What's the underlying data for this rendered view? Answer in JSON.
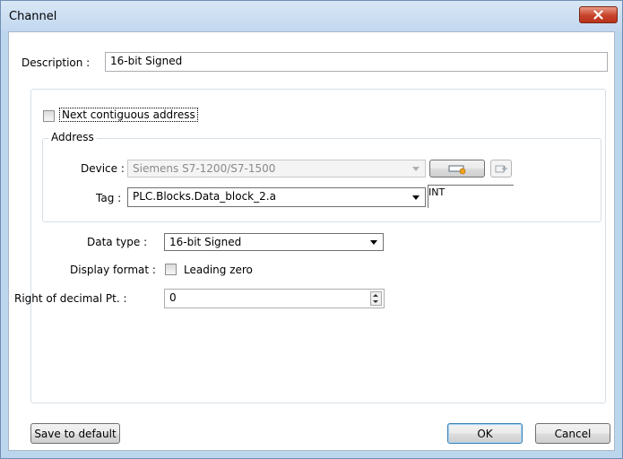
{
  "window": {
    "title": "Channel"
  },
  "description": {
    "label": "Description :",
    "value": "16-bit Signed"
  },
  "contiguous": {
    "label": "Next contiguous address",
    "checked": false
  },
  "address": {
    "group_label": "Address",
    "device_label": "Device :",
    "device_value": "Siemens S7-1200/S7-1500",
    "tag_label": "Tag :",
    "tag_value": "PLC.Blocks.Data_block_2.a",
    "tag_type": "INT"
  },
  "data_type": {
    "label": "Data type :",
    "value": "16-bit Signed"
  },
  "display_format": {
    "label": "Display format :",
    "option_label": "Leading zero",
    "checked": false
  },
  "decimal": {
    "label": "Right of decimal Pt. :",
    "value": "0"
  },
  "buttons": {
    "save_default": "Save to default",
    "ok": "OK",
    "cancel": "Cancel"
  },
  "colors": {
    "title_bar": "#c8dcf0",
    "close_button": "#c7432a",
    "frame": "#bcd6ee"
  }
}
